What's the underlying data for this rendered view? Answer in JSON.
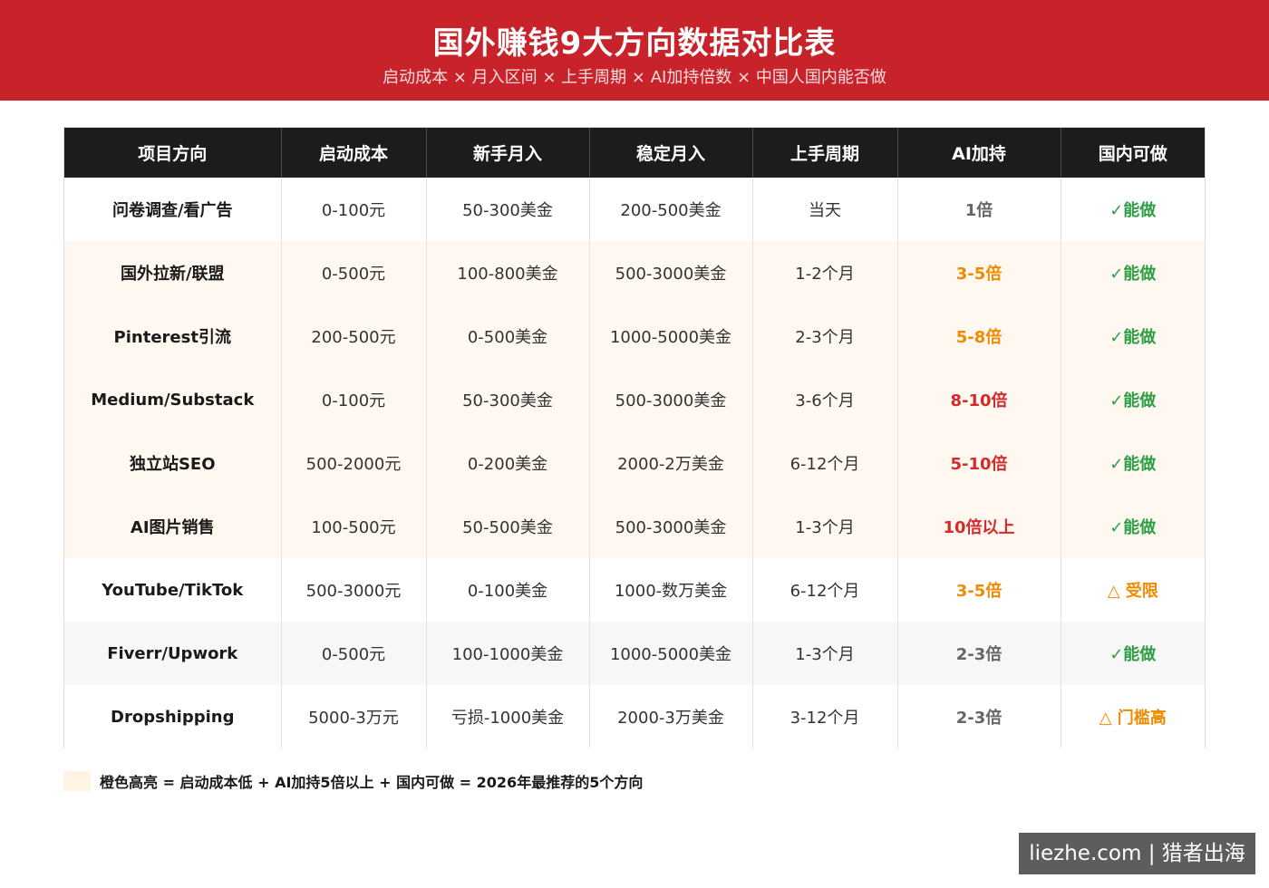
{
  "header": {
    "title": "国外赚钱9大方向数据对比表",
    "subtitle": "启动成本 × 月入区间 × 上手周期 × AI加持倍数 × 中国人国内能否做"
  },
  "colors": {
    "banner": "#c8232b",
    "header_row": "#1c1c1c",
    "highlight_row": "#fff8f0",
    "ai_orange": "#f08a00",
    "ai_red": "#d42a2a",
    "domestic_yes": "#2e9e45",
    "domestic_limited": "#f08a00"
  },
  "table": {
    "columns": [
      "项目方向",
      "启动成本",
      "新手月入",
      "稳定月入",
      "上手周期",
      "AI加持",
      "国内可做"
    ],
    "rows": [
      {
        "project": "问卷调查/看广告",
        "cost": "0-100元",
        "newbie": "50-300美金",
        "stable": "200-500美金",
        "period": "当天",
        "ai": "1倍",
        "domestic": "✓能做",
        "bg": "white",
        "ai_style": "gray",
        "domestic_style": "green"
      },
      {
        "project": "国外拉新/联盟",
        "cost": "0-500元",
        "newbie": "100-800美金",
        "stable": "500-3000美金",
        "period": "1-2个月",
        "ai": "3-5倍",
        "domestic": "✓能做",
        "bg": "cream",
        "ai_style": "orange",
        "domestic_style": "green"
      },
      {
        "project": "Pinterest引流",
        "cost": "200-500元",
        "newbie": "0-500美金",
        "stable": "1000-5000美金",
        "period": "2-3个月",
        "ai": "5-8倍",
        "domestic": "✓能做",
        "bg": "cream",
        "ai_style": "orange",
        "domestic_style": "green"
      },
      {
        "project": "Medium/Substack",
        "cost": "0-100元",
        "newbie": "50-300美金",
        "stable": "500-3000美金",
        "period": "3-6个月",
        "ai": "8-10倍",
        "domestic": "✓能做",
        "bg": "cream",
        "ai_style": "red",
        "domestic_style": "green"
      },
      {
        "project": "独立站SEO",
        "cost": "500-2000元",
        "newbie": "0-200美金",
        "stable": "2000-2万美金",
        "period": "6-12个月",
        "ai": "5-10倍",
        "domestic": "✓能做",
        "bg": "cream",
        "ai_style": "red",
        "domestic_style": "green"
      },
      {
        "project": "AI图片销售",
        "cost": "100-500元",
        "newbie": "50-500美金",
        "stable": "500-3000美金",
        "period": "1-3个月",
        "ai": "10倍以上",
        "domestic": "✓能做",
        "bg": "cream",
        "ai_style": "red",
        "domestic_style": "green"
      },
      {
        "project": "YouTube/TikTok",
        "cost": "500-3000元",
        "newbie": "0-100美金",
        "stable": "1000-数万美金",
        "period": "6-12个月",
        "ai": "3-5倍",
        "domestic": "△ 受限",
        "bg": "white",
        "ai_style": "orange",
        "domestic_style": "orange"
      },
      {
        "project": "Fiverr/Upwork",
        "cost": "0-500元",
        "newbie": "100-1000美金",
        "stable": "1000-5000美金",
        "period": "1-3个月",
        "ai": "2-3倍",
        "domestic": "✓能做",
        "bg": "gray",
        "ai_style": "gray",
        "domestic_style": "green"
      },
      {
        "project": "Dropshipping",
        "cost": "5000-3万元",
        "newbie": "亏损-1000美金",
        "stable": "2000-3万美金",
        "period": "3-12个月",
        "ai": "2-3倍",
        "domestic": "△ 门槛高",
        "bg": "white",
        "ai_style": "gray",
        "domestic_style": "orange"
      }
    ]
  },
  "legend": {
    "text": "橙色高亮 = 启动成本低 + AI加持5倍以上 + 国内可做 = 2026年最推荐的5个方向"
  },
  "watermark": {
    "text": "liezhe.com | 猎者出海"
  }
}
